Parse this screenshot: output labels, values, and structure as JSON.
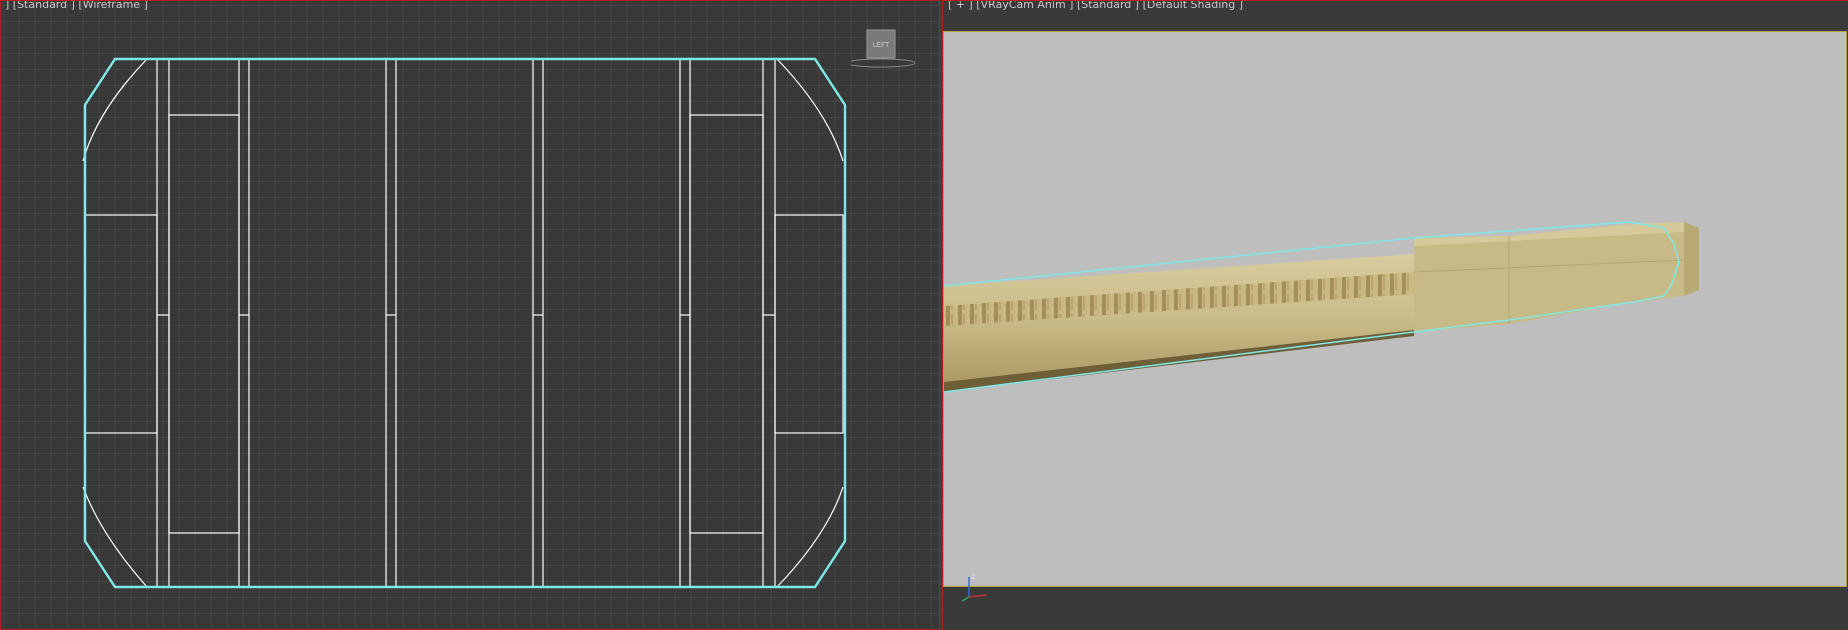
{
  "viewports": {
    "left": {
      "label": "] [Standard ] [Wireframe ]",
      "view_name": "LEFT",
      "mode": "wireframe"
    },
    "right": {
      "label": "[ + ] [VRayCam Anim ] [Standard ] [Default Shading ]",
      "mode": "shaded"
    }
  },
  "gizmo": {
    "z_label": "z",
    "y_label": "y",
    "x_label": "x"
  },
  "colors": {
    "viewport_bg": "#3a3a3a",
    "grid": "#4e4e4e",
    "wire": "#ffffff",
    "selection": "#7fe8e8",
    "active_border": "#b02020",
    "render_bg": "#bebebe",
    "render_frame": "#b8a240",
    "wood": "#cbbd8a"
  }
}
